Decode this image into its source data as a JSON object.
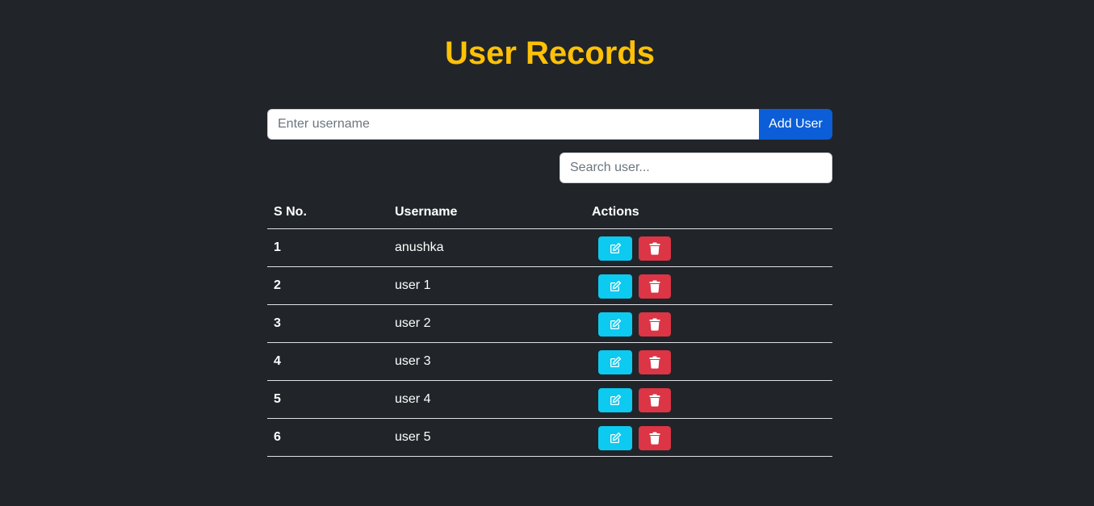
{
  "page": {
    "title": "User Records"
  },
  "add_form": {
    "placeholder": "Enter username",
    "value": "",
    "button_label": "Add User"
  },
  "search": {
    "placeholder": "Search user...",
    "value": ""
  },
  "table": {
    "headers": [
      "S No.",
      "Username",
      "Actions"
    ],
    "rows": [
      {
        "sno": "1",
        "username": "anushka"
      },
      {
        "sno": "2",
        "username": "user 1"
      },
      {
        "sno": "3",
        "username": "user 2"
      },
      {
        "sno": "4",
        "username": "user 3"
      },
      {
        "sno": "5",
        "username": "user 4"
      },
      {
        "sno": "6",
        "username": "user 5"
      }
    ],
    "row_actions": [
      {
        "name": "edit",
        "icon": "edit-icon",
        "color": "#0dcaf0"
      },
      {
        "name": "delete",
        "icon": "trash-icon",
        "color": "#dc3545"
      }
    ]
  },
  "colors": {
    "background": "#212529",
    "title": "#ffc107",
    "primary": "#0b5ed7",
    "info": "#0dcaf0",
    "danger": "#dc3545"
  }
}
